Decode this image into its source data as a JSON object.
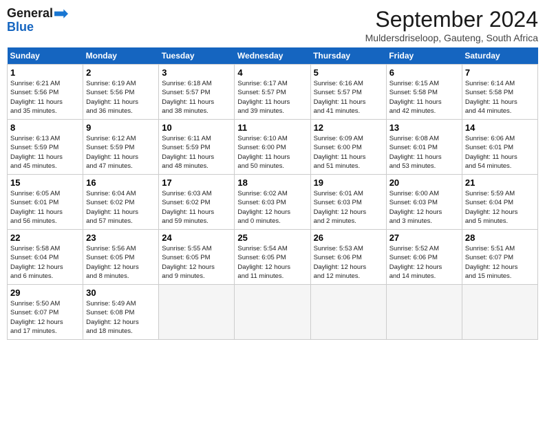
{
  "header": {
    "logo_line1": "General",
    "logo_line2": "Blue",
    "month": "September 2024",
    "location": "Muldersdriseloop, Gauteng, South Africa"
  },
  "weekdays": [
    "Sunday",
    "Monday",
    "Tuesday",
    "Wednesday",
    "Thursday",
    "Friday",
    "Saturday"
  ],
  "weeks": [
    [
      {
        "day": "1",
        "sunrise": "6:21 AM",
        "sunset": "5:56 PM",
        "daylight": "11 hours and 35 minutes."
      },
      {
        "day": "2",
        "sunrise": "6:19 AM",
        "sunset": "5:56 PM",
        "daylight": "11 hours and 36 minutes."
      },
      {
        "day": "3",
        "sunrise": "6:18 AM",
        "sunset": "5:57 PM",
        "daylight": "11 hours and 38 minutes."
      },
      {
        "day": "4",
        "sunrise": "6:17 AM",
        "sunset": "5:57 PM",
        "daylight": "11 hours and 39 minutes."
      },
      {
        "day": "5",
        "sunrise": "6:16 AM",
        "sunset": "5:57 PM",
        "daylight": "11 hours and 41 minutes."
      },
      {
        "day": "6",
        "sunrise": "6:15 AM",
        "sunset": "5:58 PM",
        "daylight": "11 hours and 42 minutes."
      },
      {
        "day": "7",
        "sunrise": "6:14 AM",
        "sunset": "5:58 PM",
        "daylight": "11 hours and 44 minutes."
      }
    ],
    [
      {
        "day": "8",
        "sunrise": "6:13 AM",
        "sunset": "5:59 PM",
        "daylight": "11 hours and 45 minutes."
      },
      {
        "day": "9",
        "sunrise": "6:12 AM",
        "sunset": "5:59 PM",
        "daylight": "11 hours and 47 minutes."
      },
      {
        "day": "10",
        "sunrise": "6:11 AM",
        "sunset": "5:59 PM",
        "daylight": "11 hours and 48 minutes."
      },
      {
        "day": "11",
        "sunrise": "6:10 AM",
        "sunset": "6:00 PM",
        "daylight": "11 hours and 50 minutes."
      },
      {
        "day": "12",
        "sunrise": "6:09 AM",
        "sunset": "6:00 PM",
        "daylight": "11 hours and 51 minutes."
      },
      {
        "day": "13",
        "sunrise": "6:08 AM",
        "sunset": "6:01 PM",
        "daylight": "11 hours and 53 minutes."
      },
      {
        "day": "14",
        "sunrise": "6:06 AM",
        "sunset": "6:01 PM",
        "daylight": "11 hours and 54 minutes."
      }
    ],
    [
      {
        "day": "15",
        "sunrise": "6:05 AM",
        "sunset": "6:01 PM",
        "daylight": "11 hours and 56 minutes."
      },
      {
        "day": "16",
        "sunrise": "6:04 AM",
        "sunset": "6:02 PM",
        "daylight": "11 hours and 57 minutes."
      },
      {
        "day": "17",
        "sunrise": "6:03 AM",
        "sunset": "6:02 PM",
        "daylight": "11 hours and 59 minutes."
      },
      {
        "day": "18",
        "sunrise": "6:02 AM",
        "sunset": "6:03 PM",
        "daylight": "12 hours and 0 minutes."
      },
      {
        "day": "19",
        "sunrise": "6:01 AM",
        "sunset": "6:03 PM",
        "daylight": "12 hours and 2 minutes."
      },
      {
        "day": "20",
        "sunrise": "6:00 AM",
        "sunset": "6:03 PM",
        "daylight": "12 hours and 3 minutes."
      },
      {
        "day": "21",
        "sunrise": "5:59 AM",
        "sunset": "6:04 PM",
        "daylight": "12 hours and 5 minutes."
      }
    ],
    [
      {
        "day": "22",
        "sunrise": "5:58 AM",
        "sunset": "6:04 PM",
        "daylight": "12 hours and 6 minutes."
      },
      {
        "day": "23",
        "sunrise": "5:56 AM",
        "sunset": "6:05 PM",
        "daylight": "12 hours and 8 minutes."
      },
      {
        "day": "24",
        "sunrise": "5:55 AM",
        "sunset": "6:05 PM",
        "daylight": "12 hours and 9 minutes."
      },
      {
        "day": "25",
        "sunrise": "5:54 AM",
        "sunset": "6:05 PM",
        "daylight": "12 hours and 11 minutes."
      },
      {
        "day": "26",
        "sunrise": "5:53 AM",
        "sunset": "6:06 PM",
        "daylight": "12 hours and 12 minutes."
      },
      {
        "day": "27",
        "sunrise": "5:52 AM",
        "sunset": "6:06 PM",
        "daylight": "12 hours and 14 minutes."
      },
      {
        "day": "28",
        "sunrise": "5:51 AM",
        "sunset": "6:07 PM",
        "daylight": "12 hours and 15 minutes."
      }
    ],
    [
      {
        "day": "29",
        "sunrise": "5:50 AM",
        "sunset": "6:07 PM",
        "daylight": "12 hours and 17 minutes."
      },
      {
        "day": "30",
        "sunrise": "5:49 AM",
        "sunset": "6:08 PM",
        "daylight": "12 hours and 18 minutes."
      },
      null,
      null,
      null,
      null,
      null
    ]
  ]
}
